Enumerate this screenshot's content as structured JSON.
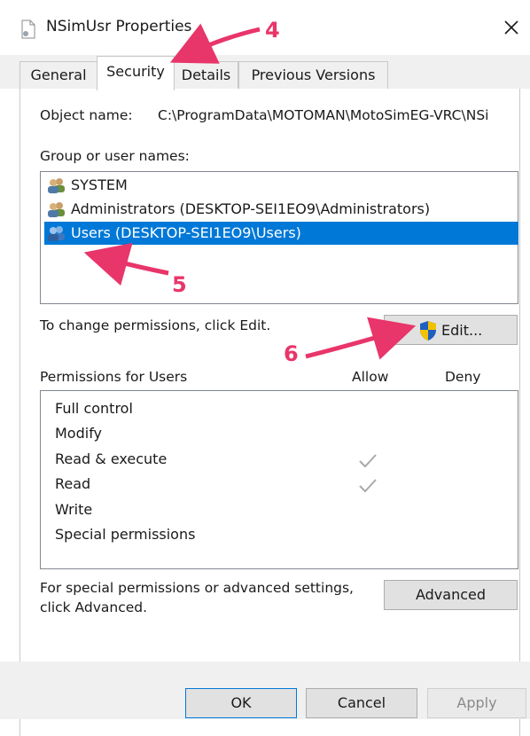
{
  "window": {
    "title": "NSimUsr Properties",
    "close_glyph": "✕"
  },
  "tabs": [
    {
      "label": "General",
      "active": false
    },
    {
      "label": "Security",
      "active": true
    },
    {
      "label": "Details",
      "active": false
    },
    {
      "label": "Previous Versions",
      "active": false
    }
  ],
  "security": {
    "object_name_label": "Object name:",
    "object_name_value": "C:\\ProgramData\\MOTOMAN\\MotoSimEG-VRC\\NSi",
    "group_label": "Group or user names:",
    "users": [
      {
        "name": "SYSTEM",
        "selected": false,
        "icon": "users-group-icon"
      },
      {
        "name": "Administrators (DESKTOP-SEI1EO9\\Administrators)",
        "selected": false,
        "icon": "users-group-icon"
      },
      {
        "name": "Users (DESKTOP-SEI1EO9\\Users)",
        "selected": true,
        "icon": "users-group-icon"
      }
    ],
    "change_text": "To change permissions, click Edit.",
    "edit_label": "Edit...",
    "permissions_for": "Permissions for Users",
    "allow_header": "Allow",
    "deny_header": "Deny",
    "permissions": [
      {
        "name": "Full control",
        "allow": false,
        "deny": false
      },
      {
        "name": "Modify",
        "allow": false,
        "deny": false
      },
      {
        "name": "Read & execute",
        "allow": true,
        "deny": false
      },
      {
        "name": "Read",
        "allow": true,
        "deny": false
      },
      {
        "name": "Write",
        "allow": false,
        "deny": false
      },
      {
        "name": "Special permissions",
        "allow": false,
        "deny": false
      }
    ],
    "advanced_text_line1": "For special permissions or advanced settings,",
    "advanced_text_line2": "click Advanced.",
    "advanced_label": "Advanced"
  },
  "buttons": {
    "ok": "OK",
    "cancel": "Cancel",
    "apply": "Apply"
  },
  "annotations": {
    "step4": "4",
    "step5": "5",
    "step6": "6",
    "color": "#e8356a"
  },
  "colors": {
    "selection": "#0078d7",
    "shield_blue": "#1f5fbf",
    "shield_yellow": "#f2c200"
  }
}
